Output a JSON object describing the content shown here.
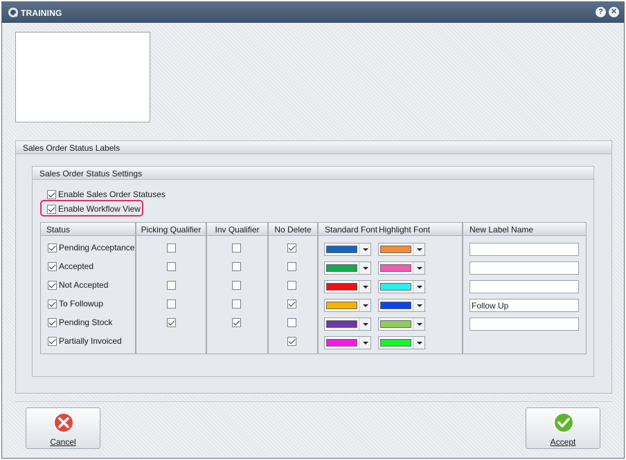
{
  "window": {
    "title": "TRAINING",
    "help_glyph": "?",
    "close_glyph": "✕"
  },
  "status_labels_panel": {
    "title": "Sales Order Status Labels"
  },
  "status_settings_panel": {
    "title": "Sales Order Status Settings",
    "enable_statuses": {
      "label": "Enable Sales Order Statuses",
      "checked": true
    },
    "enable_workflow": {
      "label": "Enable Workflow View",
      "checked": true
    }
  },
  "columns": {
    "status": "Status",
    "picking": "Picking Qualifier",
    "inv": "Inv Qualifier",
    "no_delete": "No Delete",
    "standard_font": "Standard Font",
    "highlight_font": "Highlight Font",
    "new_label": "New Label Name"
  },
  "rows": [
    {
      "status": "Pending Acceptance",
      "enabled": true,
      "picking": false,
      "inv": false,
      "no_delete": true,
      "standard_color": "#1565c0",
      "highlight_color": "#f48b3a",
      "new_label": ""
    },
    {
      "status": "Accepted",
      "enabled": true,
      "picking": false,
      "inv": false,
      "no_delete": false,
      "standard_color": "#18a84f",
      "highlight_color": "#f25cb3",
      "new_label": ""
    },
    {
      "status": "Not Accepted",
      "enabled": true,
      "picking": false,
      "inv": false,
      "no_delete": false,
      "standard_color": "#f20f16",
      "highlight_color": "#27f0ee",
      "new_label": ""
    },
    {
      "status": "To Followup",
      "enabled": true,
      "picking": false,
      "inv": false,
      "no_delete": true,
      "standard_color": "#f5b400",
      "highlight_color": "#0a45f0",
      "new_label": "Follow Up"
    },
    {
      "status": "Pending Stock",
      "enabled": true,
      "picking": true,
      "inv": true,
      "no_delete": false,
      "standard_color": "#6e36a8",
      "highlight_color": "#8fce5c",
      "new_label": ""
    },
    {
      "status": "Partially Invoiced",
      "enabled": true,
      "picking": null,
      "inv": null,
      "no_delete": true,
      "standard_color": "#f51ce5",
      "highlight_color": "#18f52a",
      "new_label": null
    }
  ],
  "buttons": {
    "cancel": "Cancel",
    "accept": "Accept"
  }
}
